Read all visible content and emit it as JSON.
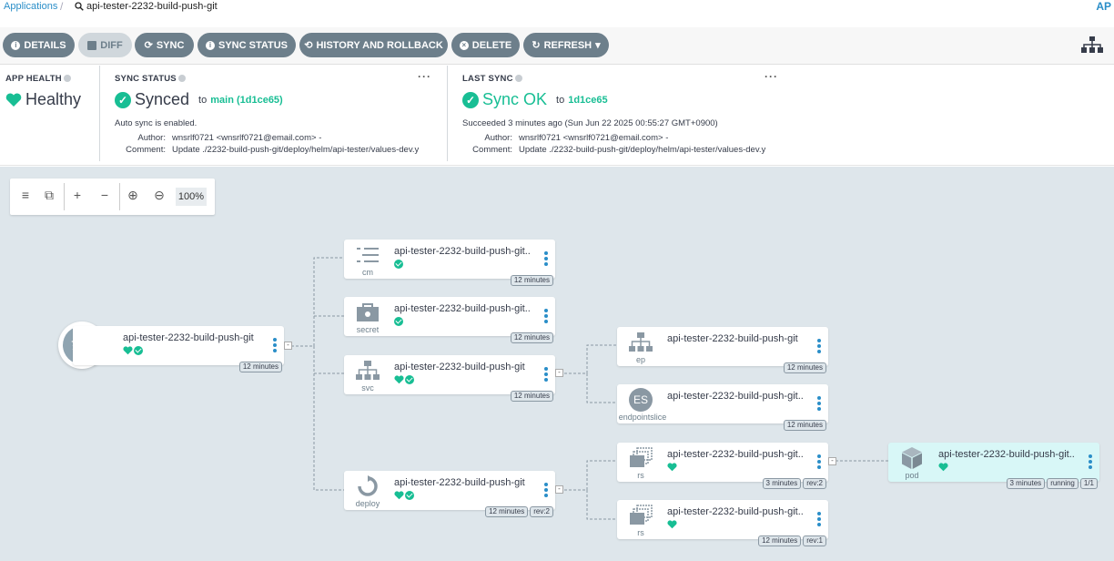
{
  "breadcrumb": {
    "link": "Applications",
    "current": "api-tester-2232-build-push-git",
    "corner": "AP"
  },
  "toolbar": {
    "details": "DETAILS",
    "diff": "DIFF",
    "sync": "SYNC",
    "sync_status": "SYNC STATUS",
    "history": "HISTORY AND ROLLBACK",
    "delete": "DELETE",
    "refresh": "REFRESH"
  },
  "app_health": {
    "title": "APP HEALTH",
    "value": "Healthy"
  },
  "sync_status": {
    "title": "SYNC STATUS",
    "value": "Synced",
    "to_label": "to",
    "target": "main (1d1ce65)",
    "auto_sync": "Auto sync is enabled.",
    "author_label": "Author:",
    "author": "wnsrlf0721 <wnsrlf0721@email.com> -",
    "comment_label": "Comment:",
    "comment": "Update ./2232-build-push-git/deploy/helm/api-tester/values-dev.y"
  },
  "last_sync": {
    "title": "LAST SYNC",
    "value": "Sync OK",
    "to_label": "to",
    "revision": "1d1ce65",
    "succeeded": "Succeeded 3 minutes ago (Sun Jun 22 2025 00:55:27 GMT+0900)",
    "author_label": "Author:",
    "author": "wnsrlf0721 <wnsrlf0721@email.com> -",
    "comment_label": "Comment:",
    "comment": "Update ./2232-build-push-git/deploy/helm/api-tester/values-dev.y"
  },
  "zoom": {
    "value": "100%"
  },
  "nodes": {
    "app": {
      "title": "api-tester-2232-build-push-git",
      "age": "12 minutes"
    },
    "cm": {
      "title": "api-tester-2232-build-push-git...",
      "kind": "cm",
      "age": "12 minutes"
    },
    "secret": {
      "title": "api-tester-2232-build-push-git...",
      "kind": "secret",
      "age": "12 minutes"
    },
    "svc": {
      "title": "api-tester-2232-build-push-git",
      "kind": "svc",
      "age": "12 minutes"
    },
    "deploy": {
      "title": "api-tester-2232-build-push-git",
      "kind": "deploy",
      "age": "12 minutes",
      "rev": "rev:2"
    },
    "ep": {
      "title": "api-tester-2232-build-push-git",
      "kind": "ep",
      "age": "12 minutes"
    },
    "endpointslice": {
      "title": "api-tester-2232-build-push-git...",
      "kind": "endpointslice",
      "badge": "ES",
      "age": "12 minutes"
    },
    "rs1": {
      "title": "api-tester-2232-build-push-git...",
      "kind": "rs",
      "age": "3 minutes",
      "rev": "rev:2"
    },
    "rs2": {
      "title": "api-tester-2232-build-push-git...",
      "kind": "rs",
      "age": "12 minutes",
      "rev": "rev:1"
    },
    "pod": {
      "title": "api-tester-2232-build-push-git...",
      "kind": "pod",
      "age": "3 minutes",
      "state": "running",
      "ready": "1/1"
    }
  },
  "colors": {
    "accent": "#2a8ec8",
    "healthy": "#18be94",
    "button": "#6d7f8b",
    "graph_bg": "#dee6eb"
  }
}
